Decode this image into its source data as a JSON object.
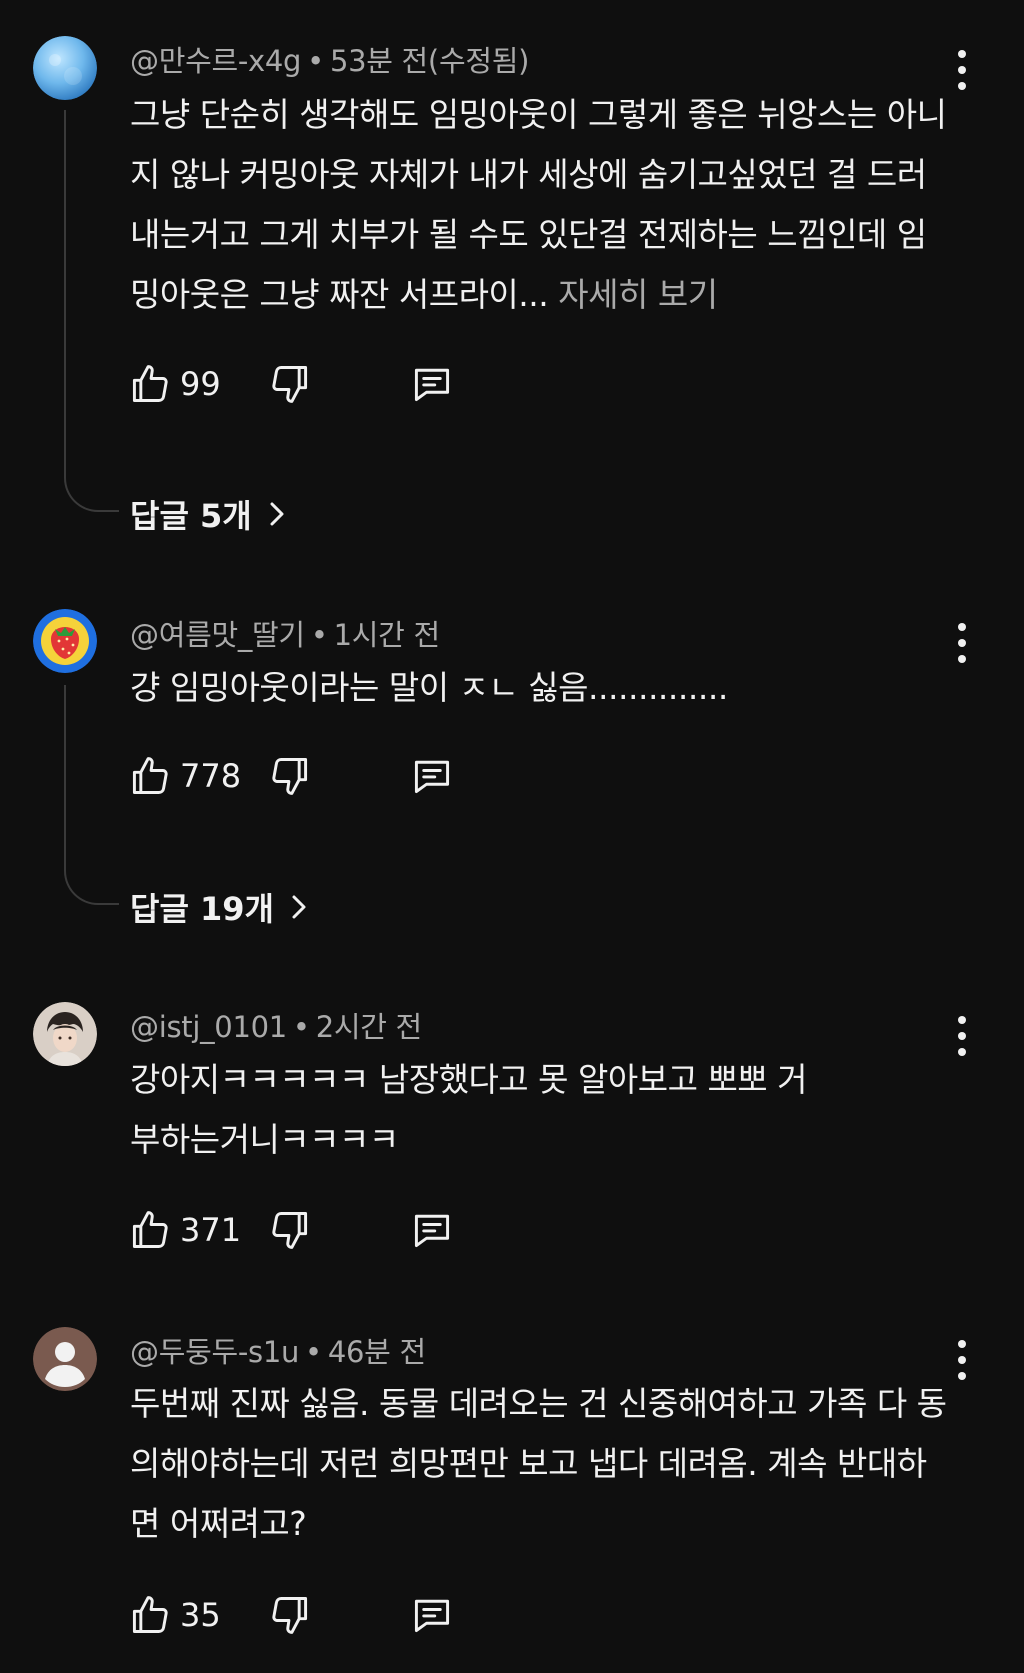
{
  "comments": [
    {
      "author": "@만수르-x4g",
      "time": "53분 전(수정됨)",
      "text": "그냥 단순히 생각해도 임밍아웃이 그렇게 좋은 뉘앙스는 아니지 않나 커밍아웃 자체가 내가 세상에 숨기고싶었던 걸 드러내는거고 그게 치부가 될 수도 있단걸 전제하는 느낌인데 임밍아웃은 그냥 짜잔 서프라이...",
      "more_label": "자세히 보기",
      "likes": "99",
      "replies_label": "답글 5개",
      "avatar_icon": "blue-planet-avatar"
    },
    {
      "author": "@여름맛_딸기",
      "time": "1시간 전",
      "text": "걍 임밍아웃이라는 말이 ㅈㄴ 싫음..............",
      "likes": "778",
      "replies_label": "답글 19개",
      "avatar_icon": "strawberry-avatar"
    },
    {
      "author": "@istj_0101",
      "time": "2시간 전",
      "text": "강아지ㅋㅋㅋㅋㅋ 남장했다고 못 알아보고 뽀뽀 거부하는거니ㅋㅋㅋㅋ",
      "likes": "371",
      "avatar_icon": "person-photo-avatar"
    },
    {
      "author": "@두둥두-s1u",
      "time": "46분 전",
      "text": "두번째 진짜 싫음. 동물 데려오는 건 신중해여하고 가족 다 동의해야하는데 저런 희망편만 보고 냅다 데려옴. 계속 반대하면 어쩌려고?",
      "likes": "35",
      "avatar_icon": "default-user-avatar"
    }
  ],
  "separator": "•",
  "colors": {
    "background": "#0f0f0f",
    "text": "#f1f1f1",
    "meta": "#aaaaaa",
    "thread": "#3a3a3a"
  }
}
